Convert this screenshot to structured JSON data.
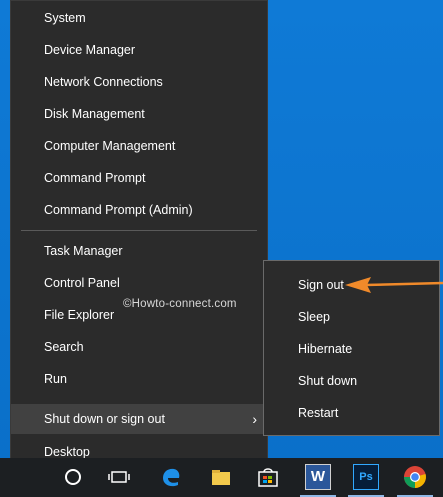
{
  "menu": {
    "items_group1": [
      {
        "label": "System"
      },
      {
        "label": "Device Manager"
      },
      {
        "label": "Network Connections"
      },
      {
        "label": "Disk Management"
      },
      {
        "label": "Computer Management"
      },
      {
        "label": "Command Prompt"
      },
      {
        "label": "Command Prompt (Admin)"
      }
    ],
    "items_group2": [
      {
        "label": "Task Manager"
      },
      {
        "label": "Control Panel"
      },
      {
        "label": "File Explorer"
      },
      {
        "label": "Search"
      },
      {
        "label": "Run"
      }
    ],
    "shutdown": {
      "label": "Shut down or sign out",
      "arrow": "›"
    },
    "desktop": {
      "label": "Desktop"
    }
  },
  "submenu": {
    "items": [
      {
        "label": "Sign out"
      },
      {
        "label": "Sleep"
      },
      {
        "label": "Hibernate"
      },
      {
        "label": "Shut down"
      },
      {
        "label": "Restart"
      }
    ]
  },
  "watermark": "©Howto-connect.com",
  "colors": {
    "desktop": "#0b78d4",
    "menu_bg": "#2b2b2b",
    "highlight": "#414141",
    "arrow_annotation": "#f08a2a",
    "taskbar": "#1c1f22"
  },
  "taskbar": {
    "icons": [
      "cortana-circle-icon",
      "task-view-icon",
      "edge-icon",
      "file-explorer-icon",
      "store-icon",
      "word-icon",
      "photoshop-icon",
      "chrome-icon"
    ],
    "word_letter": "W",
    "ps_label": "Ps"
  }
}
